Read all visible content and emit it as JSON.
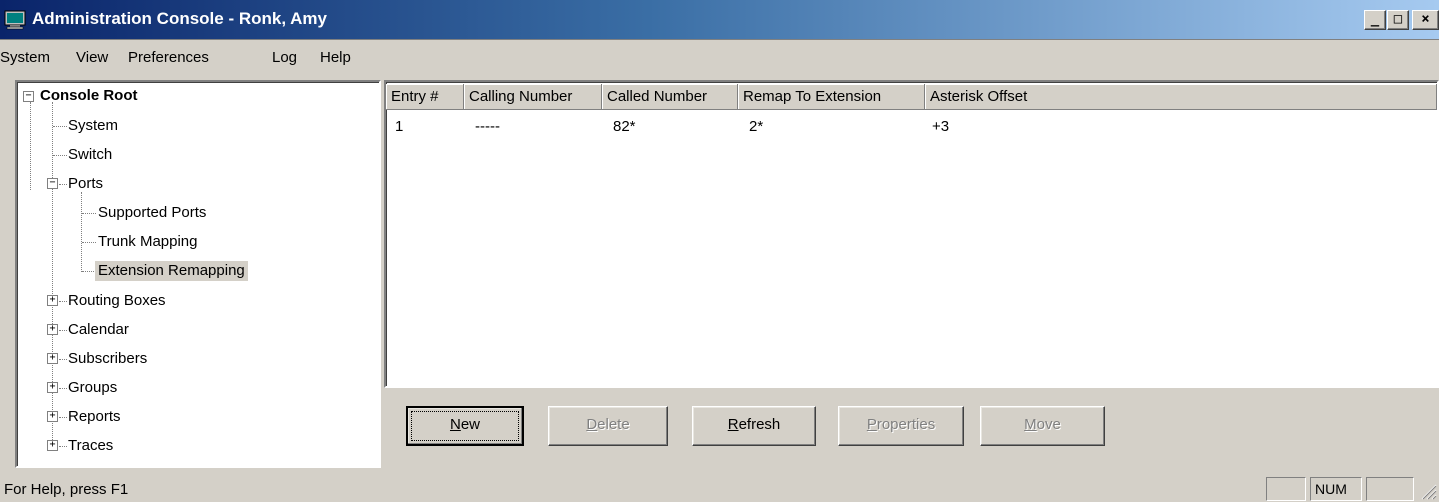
{
  "window": {
    "title": "Administration Console - Ronk, Amy",
    "minimize_glyph": "_",
    "maximize_glyph": "□",
    "close_glyph": "×"
  },
  "menu": [
    "System",
    "View",
    "Preferences",
    "Log",
    "Help"
  ],
  "tree": {
    "root": "Console Root",
    "items": {
      "system": "System",
      "switch": "Switch",
      "ports": "Ports",
      "supported_ports": "Supported Ports",
      "trunk_mapping": "Trunk Mapping",
      "extension_remapping": "Extension Remapping",
      "routing_boxes": "Routing Boxes",
      "calendar": "Calendar",
      "subscribers": "Subscribers",
      "groups": "Groups",
      "reports": "Reports",
      "traces": "Traces"
    },
    "selected": "Extension Remapping"
  },
  "table": {
    "columns": [
      "Entry #",
      "Calling Number",
      "Called Number",
      "Remap To Extension",
      "Asterisk Offset"
    ],
    "rows": [
      [
        "1",
        "-----",
        "82*",
        "2*",
        "+3"
      ]
    ]
  },
  "buttons": {
    "new": "N|ew",
    "delete": "D|elete",
    "refresh": "R|efresh",
    "properties": "P|roperties",
    "move": "M|ove"
  },
  "status": {
    "help_text": "For Help, press F1",
    "num": "NUM"
  },
  "colors": {
    "title_gradient_start": "#0a246a",
    "title_gradient_end": "#a6caf0",
    "face": "#d4d0c8"
  },
  "icons": {
    "app": "computer-console-icon",
    "expand": "plus-box-icon",
    "collapse": "minus-box-icon"
  }
}
